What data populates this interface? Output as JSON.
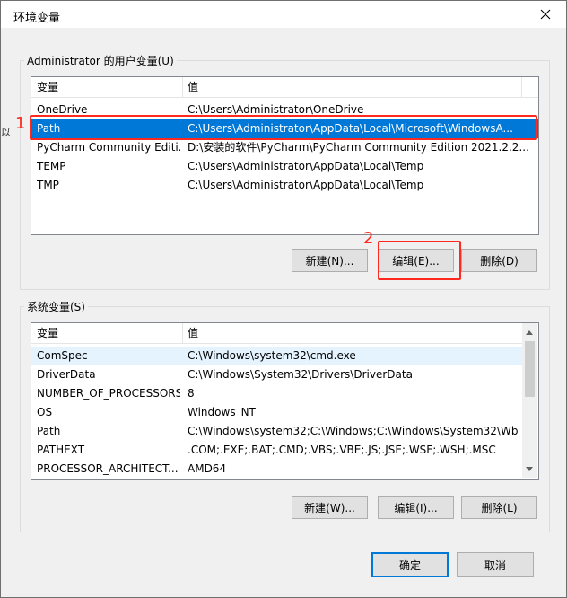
{
  "window": {
    "title": "环境变量"
  },
  "user_vars": {
    "group_label": "Administrator 的用户变量(U)",
    "columns": [
      "变量",
      "值"
    ],
    "rows": [
      {
        "name": "OneDrive",
        "value": "C:\\Users\\Administrator\\OneDrive"
      },
      {
        "name": "Path",
        "value": "C:\\Users\\Administrator\\AppData\\Local\\Microsoft\\WindowsA..."
      },
      {
        "name": "PyCharm Community Editi...",
        "value": "D:\\安装的软件\\PyCharm\\PyCharm Community Edition 2021.2.2..."
      },
      {
        "name": "TEMP",
        "value": "C:\\Users\\Administrator\\AppData\\Local\\Temp"
      },
      {
        "name": "TMP",
        "value": "C:\\Users\\Administrator\\AppData\\Local\\Temp"
      }
    ],
    "buttons": {
      "new": "新建(N)...",
      "edit": "编辑(E)...",
      "delete": "删除(D)"
    }
  },
  "system_vars": {
    "group_label": "系统变量(S)",
    "columns": [
      "变量",
      "值"
    ],
    "rows": [
      {
        "name": "ComSpec",
        "value": "C:\\Windows\\system32\\cmd.exe"
      },
      {
        "name": "DriverData",
        "value": "C:\\Windows\\System32\\Drivers\\DriverData"
      },
      {
        "name": "NUMBER_OF_PROCESSORS",
        "value": "8"
      },
      {
        "name": "OS",
        "value": "Windows_NT"
      },
      {
        "name": "Path",
        "value": "C:\\Windows\\system32;C:\\Windows;C:\\Windows\\System32\\Wb..."
      },
      {
        "name": "PATHEXT",
        "value": ".COM;.EXE;.BAT;.CMD;.VBS;.VBE;.JS;.JSE;.WSF;.WSH;.MSC"
      },
      {
        "name": "PROCESSOR_ARCHITECT...",
        "value": "AMD64"
      }
    ],
    "buttons": {
      "new": "新建(W)...",
      "edit": "编辑(I)...",
      "delete": "删除(L)"
    }
  },
  "footer": {
    "ok": "确定",
    "cancel": "取消"
  },
  "annotations": {
    "step1": "1",
    "step2": "2"
  },
  "edge_fragment": "以",
  "icons": {
    "close": "close-icon",
    "scroll_up": "scroll-up-arrow-icon",
    "scroll_down": "scroll-down-arrow-icon"
  },
  "colors": {
    "selection": "#0078d7",
    "annotation": "#ff2a1f"
  }
}
